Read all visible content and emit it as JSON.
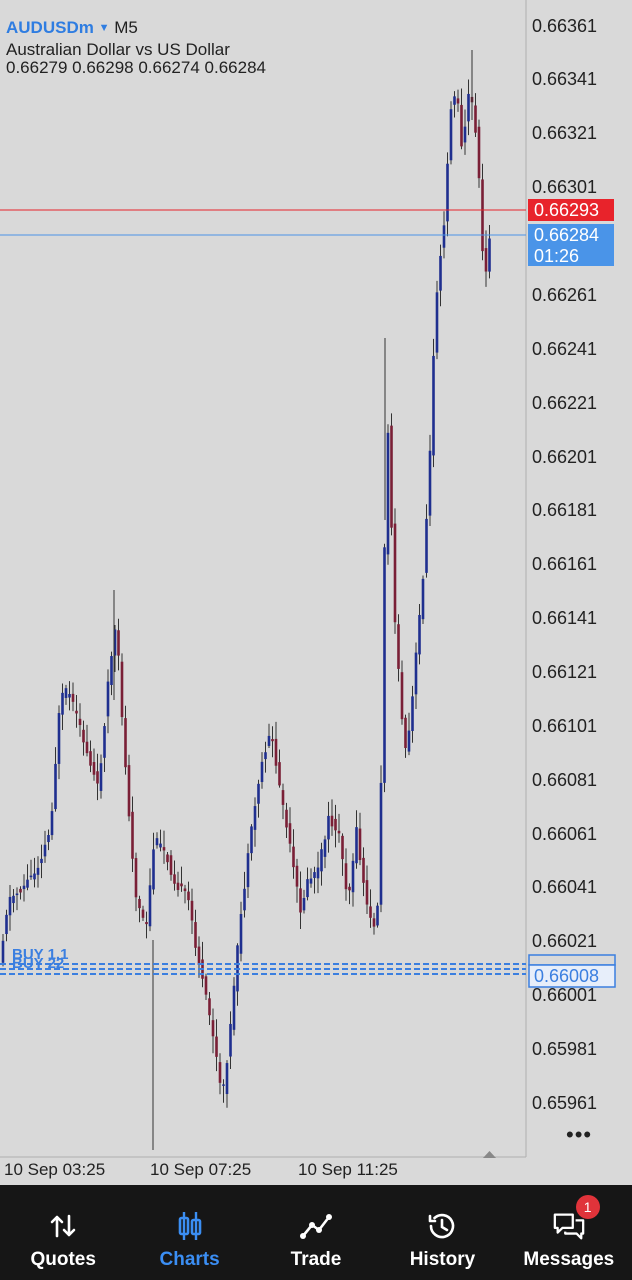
{
  "header": {
    "symbol": "AUDUSDm",
    "caret": "▼",
    "timeframe": "M5",
    "description": "Australian Dollar vs US Dollar",
    "ohlc": "0.66279 0.66298 0.66274 0.66284"
  },
  "price_axis": {
    "labels": [
      "0.66361",
      "0.66341",
      "0.66321",
      "0.66301",
      "0.66261",
      "0.66241",
      "0.66221",
      "0.66201",
      "0.66181",
      "0.66161",
      "0.66141",
      "0.66121",
      "0.66101",
      "0.66081",
      "0.66061",
      "0.66041",
      "0.66021",
      "0.66001",
      "0.65981",
      "0.65961"
    ]
  },
  "ask_line": {
    "price": "0.66293",
    "color": "#e8232b"
  },
  "bid_line": {
    "price": "0.66284",
    "countdown": "01:26",
    "color": "#4a94e8"
  },
  "positions": {
    "labels": [
      "BUY 1.1",
      "BUY 22"
    ],
    "price": "0.66008"
  },
  "time_axis": {
    "labels": [
      "10 Sep 03:25",
      "10 Sep 07:25",
      "10 Sep 11:25"
    ]
  },
  "colors": {
    "bull": "#1f2f8f",
    "bear": "#7a1f36",
    "accent": "#3b8ef3"
  },
  "nav": {
    "items": [
      {
        "label": "Quotes",
        "icon": "quotes-icon"
      },
      {
        "label": "Charts",
        "icon": "charts-icon",
        "active": true
      },
      {
        "label": "Trade",
        "icon": "trade-icon"
      },
      {
        "label": "History",
        "icon": "history-icon"
      },
      {
        "label": "Messages",
        "icon": "messages-icon",
        "badge": "1"
      }
    ]
  }
}
